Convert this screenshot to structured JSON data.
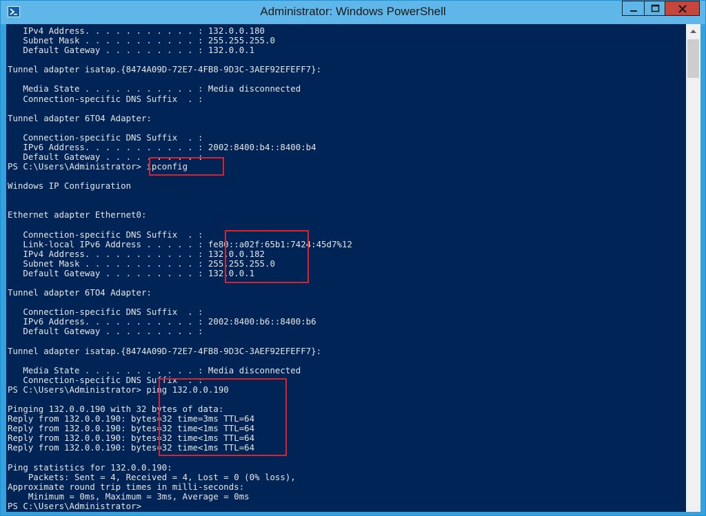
{
  "window": {
    "title": "Administrator: Windows PowerShell",
    "icon": "powershell-icon",
    "controls": [
      "minimize-icon",
      "maximize-icon",
      "close-icon"
    ]
  },
  "console": {
    "lines": [
      "   IPv4 Address. . . . . . . . . . . : 132.0.0.180",
      "   Subnet Mask . . . . . . . . . . . : 255.255.255.0",
      "   Default Gateway . . . . . . . . . : 132.0.0.1",
      "",
      "Tunnel adapter isatap.{8474A09D-72E7-4FB8-9D3C-3AEF92EFEFF7}:",
      "",
      "   Media State . . . . . . . . . . . : Media disconnected",
      "   Connection-specific DNS Suffix  . :",
      "",
      "Tunnel adapter 6TO4 Adapter:",
      "",
      "   Connection-specific DNS Suffix  . :",
      "   IPv6 Address. . . . . . . . . . . : 2002:8400:b4::8400:b4",
      "   Default Gateway . . . . . . . . . :",
      "PS C:\\Users\\Administrator> ipconfig",
      "",
      "Windows IP Configuration",
      "",
      "",
      "Ethernet adapter Ethernet0:",
      "",
      "   Connection-specific DNS Suffix  . :",
      "   Link-local IPv6 Address . . . . . : fe80::a02f:65b1:7424:45d7%12",
      "   IPv4 Address. . . . . . . . . . . : 132.0.0.182",
      "   Subnet Mask . . . . . . . . . . . : 255.255.255.0",
      "   Default Gateway . . . . . . . . . : 132.0.0.1",
      "",
      "Tunnel adapter 6TO4 Adapter:",
      "",
      "   Connection-specific DNS Suffix  . :",
      "   IPv6 Address. . . . . . . . . . . : 2002:8400:b6::8400:b6",
      "   Default Gateway . . . . . . . . . :",
      "",
      "Tunnel adapter isatap.{8474A09D-72E7-4FB8-9D3C-3AEF92EFEFF7}:",
      "",
      "   Media State . . . . . . . . . . . : Media disconnected",
      "   Connection-specific DNS Suffix  . :",
      "PS C:\\Users\\Administrator> ping 132.0.0.190",
      "",
      "Pinging 132.0.0.190 with 32 bytes of data:",
      "Reply from 132.0.0.190: bytes=32 time=3ms TTL=64",
      "Reply from 132.0.0.190: bytes=32 time<1ms TTL=64",
      "Reply from 132.0.0.190: bytes=32 time<1ms TTL=64",
      "Reply from 132.0.0.190: bytes=32 time<1ms TTL=64",
      "",
      "Ping statistics for 132.0.0.190:",
      "    Packets: Sent = 4, Received = 4, Lost = 0 (0% loss),",
      "Approximate round trip times in milli-seconds:",
      "    Minimum = 0ms, Maximum = 3ms, Average = 0ms",
      "PS C:\\Users\\Administrator>"
    ]
  },
  "colors": {
    "console_bg": "#012456",
    "console_text": "#e6e6e6",
    "titlebar": "#5fb6e8",
    "highlight": "#e0212b",
    "close_button": "#c7463c"
  }
}
